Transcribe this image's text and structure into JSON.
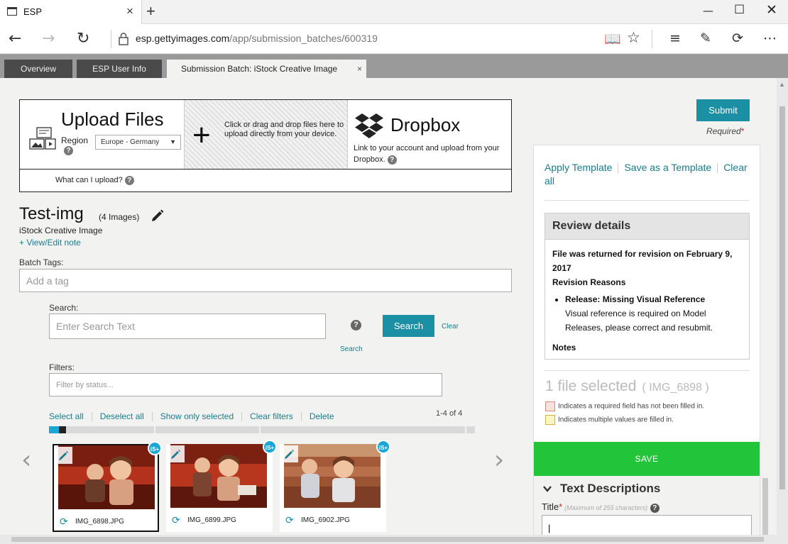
{
  "browser": {
    "tab_title": "ESP",
    "new_tab": "+",
    "url_host": "esp.gettyimages.com",
    "url_path": "/app/submission_batches/600319"
  },
  "app_tabs": [
    {
      "label": "Overview"
    },
    {
      "label": "ESP User Info"
    },
    {
      "label": "Submission Batch: iStock Creative Image",
      "close": "×"
    }
  ],
  "upload": {
    "title": "Upload Files",
    "region_label": "Region",
    "region_value": "Europe - Germany",
    "drop_text": "Click or drag and drop files here to upload directly from your device.",
    "dropbox_title": "Dropbox",
    "dropbox_text": "Link to your account and upload from your Dropbox.",
    "what_can": "What can I upload?"
  },
  "batch": {
    "name": "Test-img",
    "count": "(4 Images)",
    "type": "iStock Creative Image",
    "view_note": "+ View/Edit note",
    "tags_label": "Batch Tags:",
    "tags_placeholder": "Add a tag"
  },
  "search": {
    "label": "Search:",
    "placeholder": "Enter Search Text",
    "button": "Search",
    "clear": "Clear",
    "help_label": "Search",
    "help_q": "?"
  },
  "filters": {
    "label": "Filters:",
    "placeholder": "Filter by status..."
  },
  "actions": {
    "select_all": "Select all",
    "deselect_all": "Deselect all",
    "show_only_selected": "Show only selected",
    "clear_filters": "Clear filters",
    "delete": "Delete",
    "pager": "1-4 of 4"
  },
  "thumbnails": [
    {
      "filename": "IMG_6898.JPG",
      "badge": "iS+",
      "selected": true
    },
    {
      "filename": "IMG_6899.JPG",
      "badge": "iS+",
      "selected": false
    },
    {
      "filename": "IMG_6902.JPG",
      "badge": "iS+",
      "selected": false
    }
  ],
  "sidebar": {
    "submit": "Submit",
    "required": "Required",
    "apply_template": "Apply Template",
    "save_template": "Save as a Template",
    "clear_all": "Clear all",
    "review": {
      "title": "Review details",
      "returned": "File was returned for revision on February 9, 2017",
      "reasons_title": "Revision Reasons",
      "reason_title": "Release: Missing Visual Reference",
      "reason_text": "Visual reference is required on Model Releases, please correct and resubmit.",
      "notes": "Notes"
    },
    "selected": "1 file selected",
    "selected_file": "( IMG_6898 )",
    "legend_required": "Indicates a required field has not been filled in.",
    "legend_multiple": "Indicates multiple values are filled in.",
    "save": "SAVE",
    "text_desc": "Text Descriptions",
    "title_label": "Title",
    "title_hint": "(Maximum of 255 characters)",
    "title_value": "|"
  },
  "colors": {
    "accent": "#1b8fa3",
    "save_green": "#22c43a",
    "badge_blue": "#1ba7d6",
    "required_swatch": "#f7e2de",
    "multiple_swatch": "#fcf6c2"
  }
}
